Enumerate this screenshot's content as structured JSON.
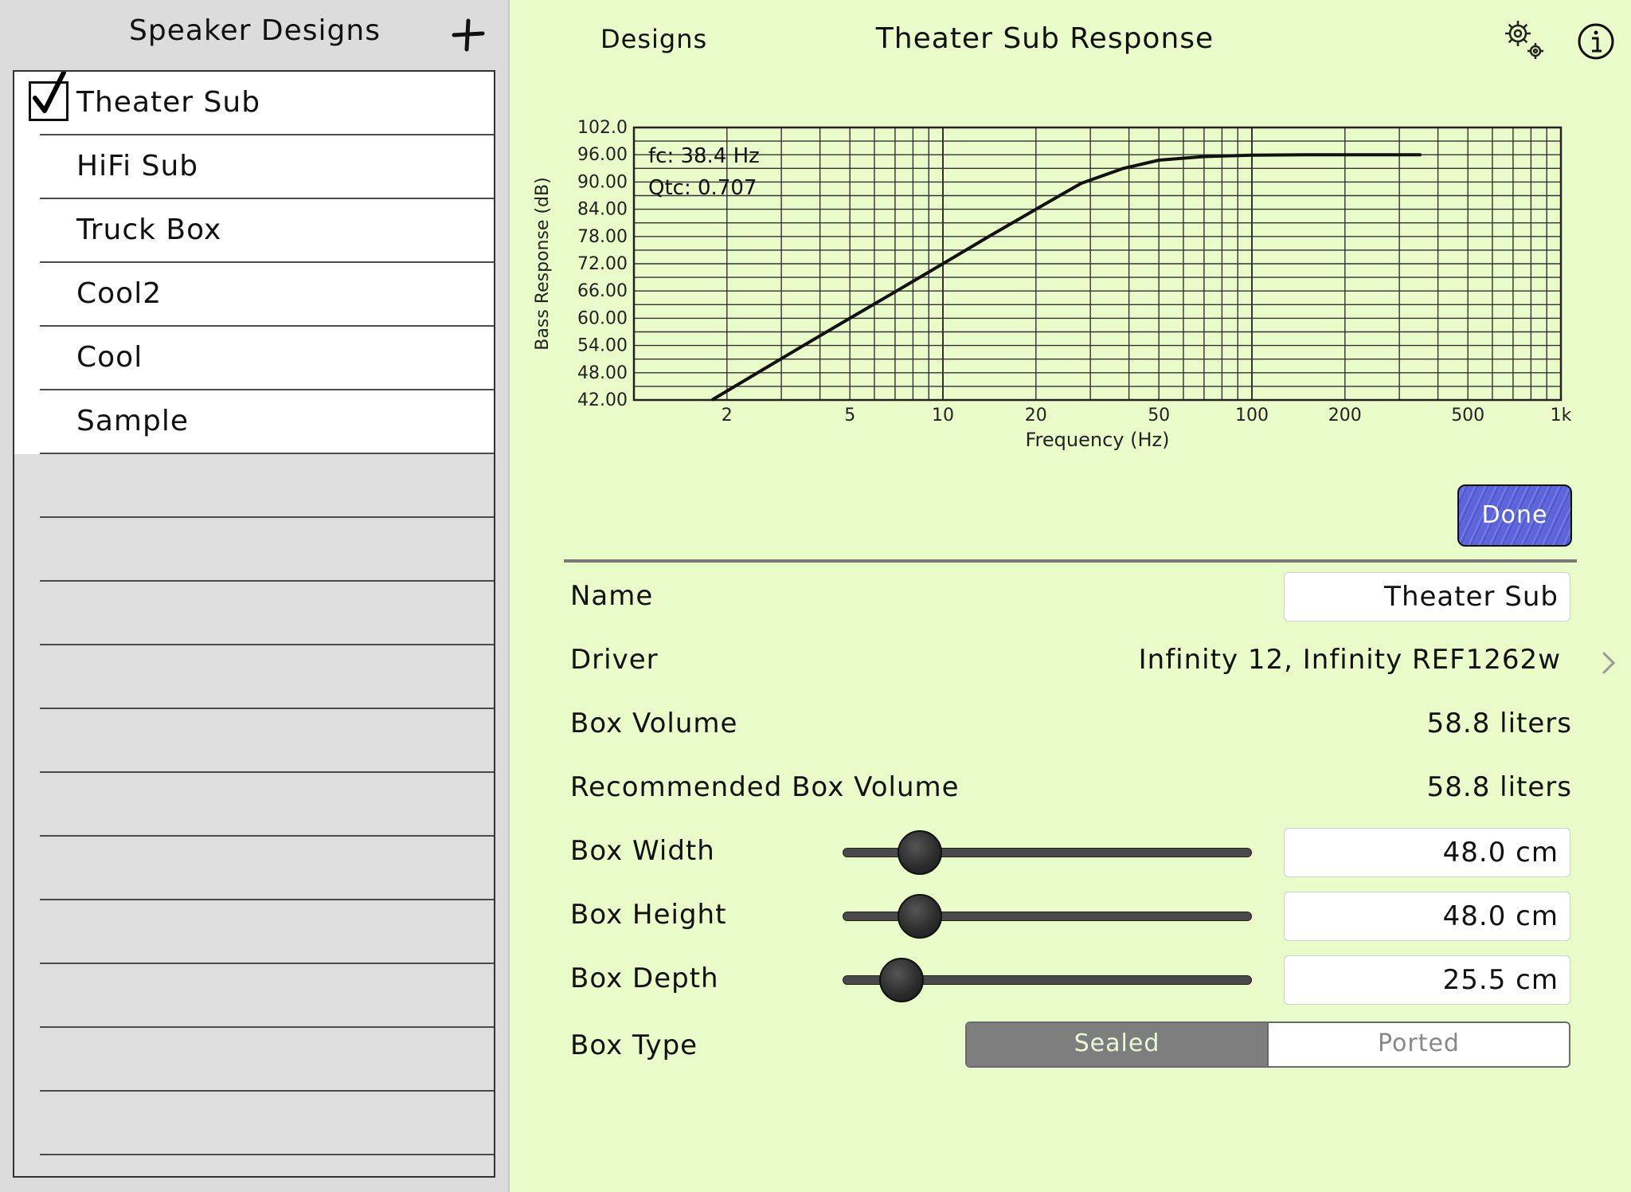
{
  "sidebar": {
    "title": "Speaker Designs",
    "add_icon": "plus-icon",
    "items": [
      {
        "label": "Theater Sub",
        "checked": true
      },
      {
        "label": "HiFi Sub",
        "checked": false
      },
      {
        "label": "Truck Box",
        "checked": false
      },
      {
        "label": "Cool2",
        "checked": false
      },
      {
        "label": "Cool",
        "checked": false
      },
      {
        "label": "Sample",
        "checked": false
      }
    ]
  },
  "nav": {
    "back_label": "Designs",
    "title": "Theater Sub Response",
    "settings_icon": "gear-icon",
    "info_icon": "info-icon"
  },
  "chart_data": {
    "type": "line",
    "xlabel": "Frequency (Hz)",
    "ylabel": "Bass Response (dB)",
    "x_scale": "log",
    "xlim": [
      1,
      1000
    ],
    "ylim": [
      42,
      102
    ],
    "yticks": [
      "42.00",
      "48.00",
      "54.00",
      "60.00",
      "66.00",
      "72.00",
      "78.00",
      "84.00",
      "90.00",
      "96.00",
      "102.0"
    ],
    "xticks": [
      {
        "v": 2,
        "label": "2"
      },
      {
        "v": 5,
        "label": "5"
      },
      {
        "v": 10,
        "label": "10"
      },
      {
        "v": 20,
        "label": "20"
      },
      {
        "v": 50,
        "label": "50"
      },
      {
        "v": 100,
        "label": "100"
      },
      {
        "v": 200,
        "label": "200"
      },
      {
        "v": 500,
        "label": "500"
      },
      {
        "v": 1000,
        "label": "1k"
      }
    ],
    "grid": true,
    "annotations": [
      "fc: 38.4 Hz",
      "Qtc: 0.707"
    ],
    "series": [
      {
        "x": [
          1.8,
          2.5,
          3.5,
          5,
          7,
          10,
          14,
          20,
          28,
          38.4,
          50,
          70,
          100,
          150,
          200,
          300,
          350
        ],
        "y": [
          42.1,
          47.9,
          53.8,
          60.0,
          65.8,
          72.0,
          77.9,
          84.0,
          89.7,
          93.0,
          94.8,
          95.6,
          95.9,
          96.0,
          96.0,
          96.0,
          96.0
        ]
      }
    ]
  },
  "done_label": "Done",
  "properties": {
    "name_label": "Name",
    "name_value": "Theater Sub",
    "driver_label": "Driver",
    "driver_value": "Infinity 12, Infinity REF1262w",
    "box_volume_label": "Box Volume",
    "box_volume_value": "58.8 liters",
    "rec_volume_label": "Recommended Box Volume",
    "rec_volume_value": "58.8 liters",
    "box_width_label": "Box Width",
    "box_width_value": "48.0 cm",
    "box_width_level": 0.15,
    "box_height_label": "Box Height",
    "box_height_value": "48.0 cm",
    "box_height_level": 0.15,
    "box_depth_label": "Box Depth",
    "box_depth_value": "25.5 cm",
    "box_depth_level": 0.1,
    "box_type_label": "Box Type",
    "box_type_options": [
      "Sealed",
      "Ported"
    ],
    "box_type_selected": "Sealed"
  }
}
